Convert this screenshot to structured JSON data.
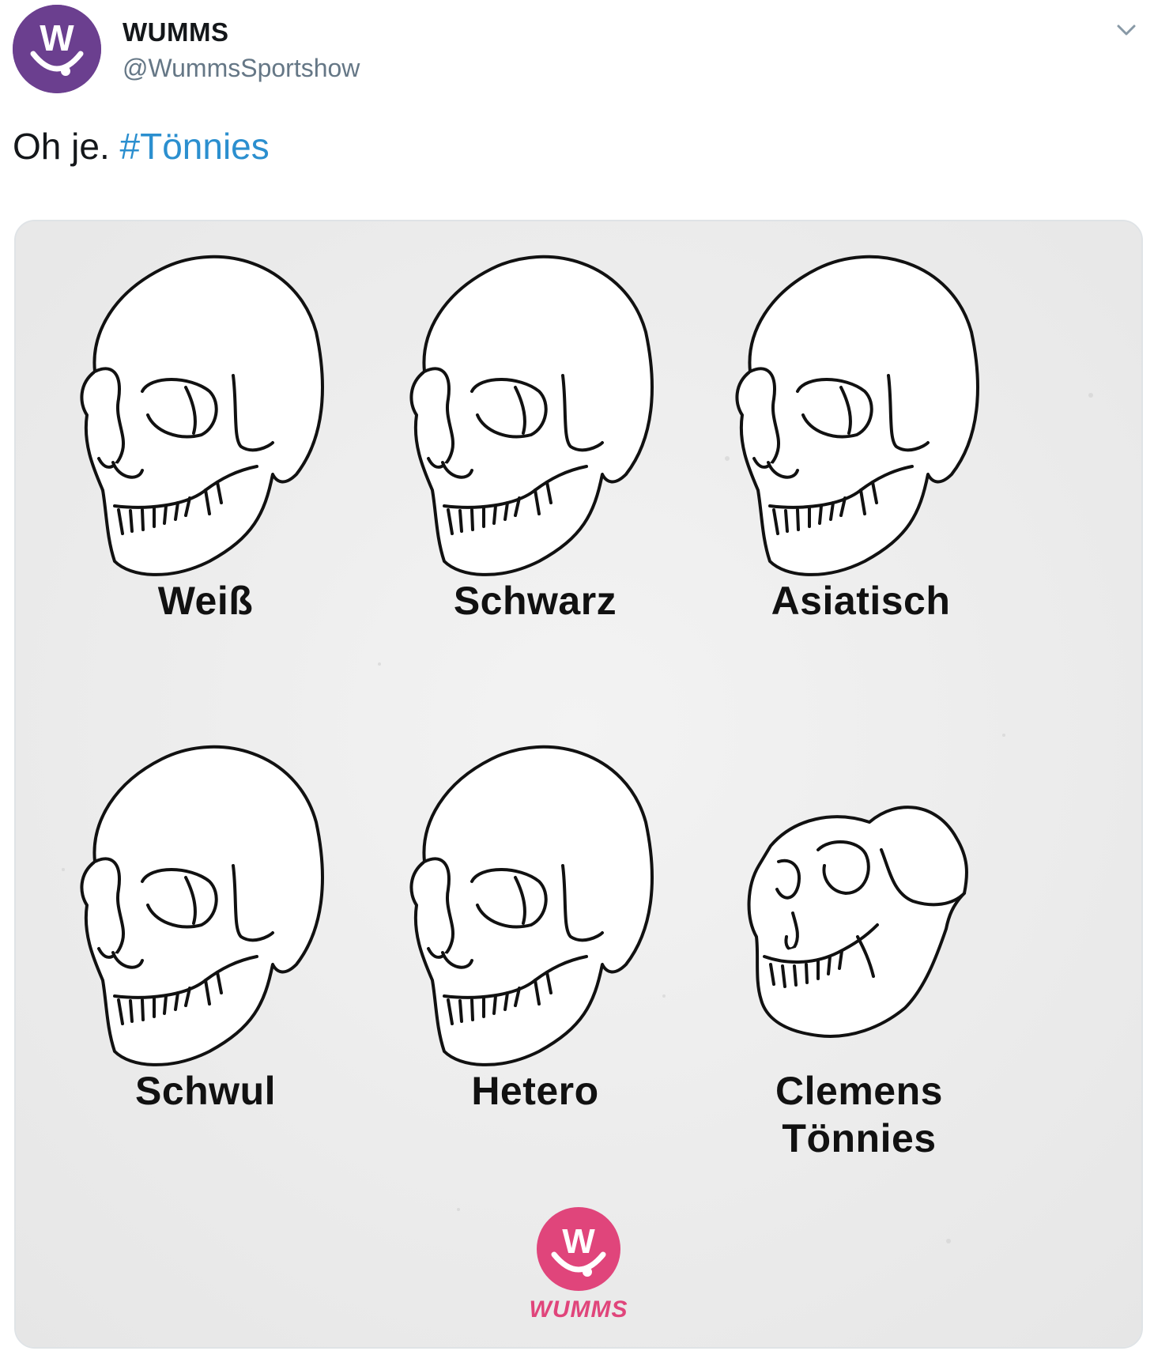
{
  "account": {
    "display_name": "WUMMS",
    "handle": "@WummsSportshow",
    "avatar_color": "#6b3f8f",
    "avatar_letter": "W"
  },
  "tweet": {
    "text": "Oh je.",
    "hashtag": "#Tönnies"
  },
  "menu": {
    "icon": "chevron-down-icon"
  },
  "colors": {
    "hashtag": "#2b8fcf",
    "brand_pink": "#e0457b",
    "handle_gray": "#657786"
  },
  "image": {
    "labels": {
      "weiss": "Weiß",
      "schwarz": "Schwarz",
      "asiatisch": "Asiatisch",
      "schwul": "Schwul",
      "hetero": "Hetero",
      "clemens_line1": "Clemens",
      "clemens_line2": "Tönnies"
    },
    "brand": "WUMMS",
    "brand_letter": "W"
  }
}
